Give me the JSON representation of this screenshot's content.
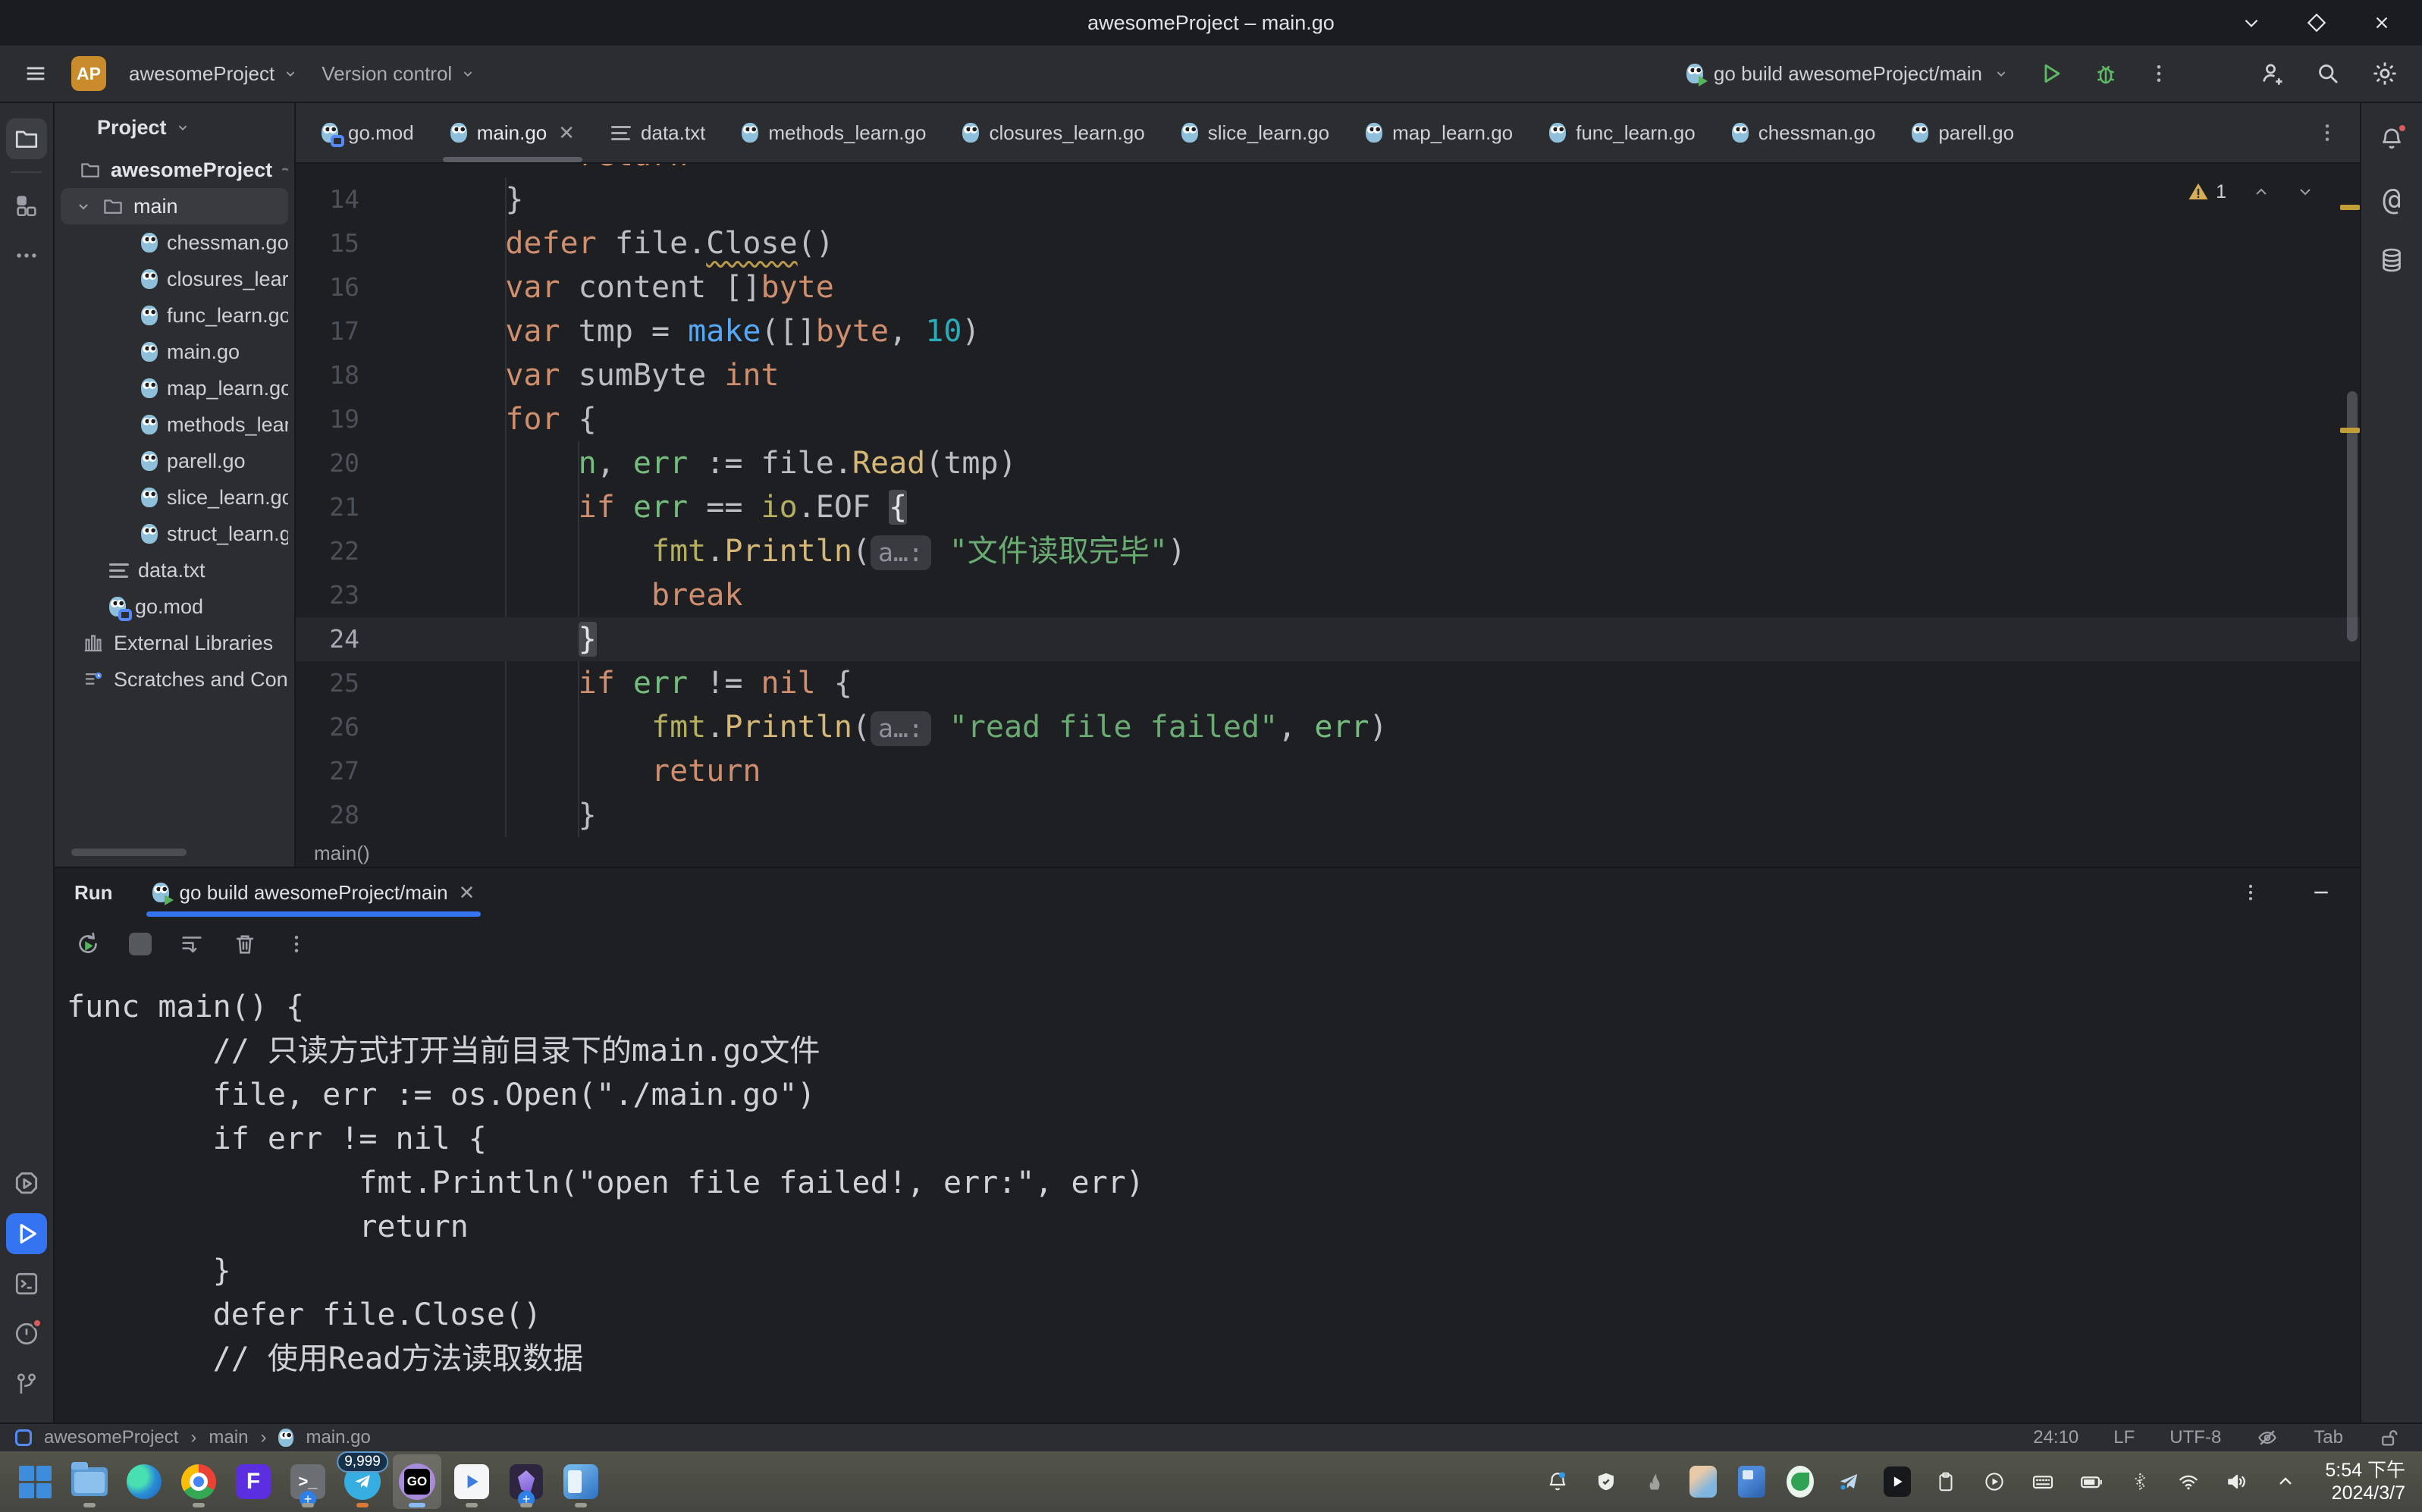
{
  "window": {
    "title": "awesomeProject – main.go"
  },
  "toolbar": {
    "project_abbrev": "AP",
    "project_name": "awesomeProject",
    "version_control_label": "Version control",
    "run_config": "go build awesomeProject/main"
  },
  "project_panel": {
    "header": "Project",
    "items": [
      {
        "pad": 24,
        "icon": "folder",
        "label": "awesomeProject",
        "hint": "~/Gola",
        "bold": true
      },
      {
        "pad": 18,
        "chevron": true,
        "icon": "folder",
        "label": "main",
        "selected": true
      },
      {
        "pad": 106,
        "icon": "go",
        "label": "chessman.go"
      },
      {
        "pad": 106,
        "icon": "go",
        "label": "closures_learn.go"
      },
      {
        "pad": 106,
        "icon": "go",
        "label": "func_learn.go"
      },
      {
        "pad": 106,
        "icon": "go",
        "label": "main.go"
      },
      {
        "pad": 106,
        "icon": "go",
        "label": "map_learn.go"
      },
      {
        "pad": 106,
        "icon": "go",
        "label": "methods_learn.go"
      },
      {
        "pad": 106,
        "icon": "go",
        "label": "parell.go"
      },
      {
        "pad": 106,
        "icon": "go",
        "label": "slice_learn.go"
      },
      {
        "pad": 106,
        "icon": "go",
        "label": "struct_learn.go"
      },
      {
        "pad": 64,
        "icon": "txt",
        "label": "data.txt"
      },
      {
        "pad": 64,
        "icon": "gomod",
        "label": "go.mod"
      },
      {
        "pad": 28,
        "icon": "lib",
        "label": "External Libraries"
      },
      {
        "pad": 28,
        "icon": "scratch",
        "label": "Scratches and Consoles"
      }
    ]
  },
  "editor": {
    "tabs": [
      {
        "label": "go.mod",
        "icon": "gomod"
      },
      {
        "label": "main.go",
        "icon": "go",
        "active": true,
        "close": true
      },
      {
        "label": "data.txt",
        "icon": "txt"
      },
      {
        "label": "methods_learn.go",
        "icon": "go"
      },
      {
        "label": "closures_learn.go",
        "icon": "go"
      },
      {
        "label": "slice_learn.go",
        "icon": "go"
      },
      {
        "label": "map_learn.go",
        "icon": "go"
      },
      {
        "label": "func_learn.go",
        "icon": "go"
      },
      {
        "label": "chessman.go",
        "icon": "go"
      },
      {
        "label": "parell.go",
        "icon": "go"
      }
    ],
    "warning_count": "1",
    "breadcrumb": "main()",
    "lines": [
      {
        "num": "",
        "ind": 2,
        "partial": true,
        "tokens": [
          {
            "c": "kw",
            "t": "return"
          }
        ]
      },
      {
        "num": "14",
        "ind": 1,
        "tokens": [
          {
            "c": "v",
            "t": "}"
          }
        ]
      },
      {
        "num": "15",
        "ind": 1,
        "tokens": [
          {
            "c": "kw",
            "t": "defer"
          },
          {
            "c": "v",
            "t": " file."
          },
          {
            "c": "wavy",
            "t": "Close"
          },
          {
            "c": "v",
            "t": "()"
          }
        ]
      },
      {
        "num": "16",
        "ind": 1,
        "tokens": [
          {
            "c": "kw",
            "t": "var"
          },
          {
            "c": "v",
            "t": " content []"
          },
          {
            "c": "kw",
            "t": "byte"
          }
        ]
      },
      {
        "num": "17",
        "ind": 1,
        "tokens": [
          {
            "c": "kw",
            "t": "var"
          },
          {
            "c": "v",
            "t": " tmp = "
          },
          {
            "c": "bfn",
            "t": "make"
          },
          {
            "c": "v",
            "t": "([]"
          },
          {
            "c": "kw",
            "t": "byte"
          },
          {
            "c": "v",
            "t": ", "
          },
          {
            "c": "num",
            "t": "10"
          },
          {
            "c": "v",
            "t": ")"
          }
        ]
      },
      {
        "num": "18",
        "ind": 1,
        "tokens": [
          {
            "c": "kw",
            "t": "var"
          },
          {
            "c": "v",
            "t": " sumByte "
          },
          {
            "c": "kw",
            "t": "int"
          }
        ]
      },
      {
        "num": "19",
        "ind": 1,
        "tokens": [
          {
            "c": "kw",
            "t": "for"
          },
          {
            "c": "v",
            "t": " {"
          }
        ]
      },
      {
        "num": "20",
        "ind": 2,
        "tokens": [
          {
            "c": "gv",
            "t": "n"
          },
          {
            "c": "v",
            "t": ", "
          },
          {
            "c": "gv",
            "t": "err"
          },
          {
            "c": "v",
            "t": " := file."
          },
          {
            "c": "fn",
            "t": "Read"
          },
          {
            "c": "v",
            "t": "(tmp)"
          }
        ]
      },
      {
        "num": "21",
        "ind": 2,
        "tokens": [
          {
            "c": "kw",
            "t": "if"
          },
          {
            "c": "v",
            "t": " "
          },
          {
            "c": "gv",
            "t": "err"
          },
          {
            "c": "v",
            "t": " == "
          },
          {
            "c": "pkg",
            "t": "io"
          },
          {
            "c": "v",
            "t": ".EOF "
          },
          {
            "c": "brace",
            "t": "{"
          }
        ]
      },
      {
        "num": "22",
        "ind": 3,
        "tokens": [
          {
            "c": "pkg",
            "t": "fmt"
          },
          {
            "c": "v",
            "t": "."
          },
          {
            "c": "fn",
            "t": "Println"
          },
          {
            "c": "v",
            "t": "("
          },
          {
            "c": "hint",
            "t": "a…:"
          },
          {
            "c": "v",
            "t": " "
          },
          {
            "c": "str",
            "t": "\"文件读取完毕\""
          },
          {
            "c": "v",
            "t": ")"
          }
        ]
      },
      {
        "num": "23",
        "ind": 3,
        "tokens": [
          {
            "c": "kw",
            "t": "break"
          }
        ]
      },
      {
        "num": "24",
        "ind": 2,
        "caret": true,
        "tokens": [
          {
            "c": "brace",
            "t": "}"
          }
        ]
      },
      {
        "num": "25",
        "ind": 2,
        "tokens": [
          {
            "c": "kw",
            "t": "if"
          },
          {
            "c": "v",
            "t": " "
          },
          {
            "c": "gv",
            "t": "err"
          },
          {
            "c": "v",
            "t": " != "
          },
          {
            "c": "kw",
            "t": "nil"
          },
          {
            "c": "v",
            "t": " {"
          }
        ]
      },
      {
        "num": "26",
        "ind": 3,
        "tokens": [
          {
            "c": "pkg",
            "t": "fmt"
          },
          {
            "c": "v",
            "t": "."
          },
          {
            "c": "fn",
            "t": "Println"
          },
          {
            "c": "v",
            "t": "("
          },
          {
            "c": "hint",
            "t": "a…:"
          },
          {
            "c": "v",
            "t": " "
          },
          {
            "c": "str",
            "t": "\"read file failed\""
          },
          {
            "c": "v",
            "t": ", "
          },
          {
            "c": "gv",
            "t": "err"
          },
          {
            "c": "v",
            "t": ")"
          }
        ]
      },
      {
        "num": "27",
        "ind": 3,
        "tokens": [
          {
            "c": "kw",
            "t": "return"
          }
        ]
      },
      {
        "num": "28",
        "ind": 2,
        "tokens": [
          {
            "c": "v",
            "t": "}"
          }
        ]
      }
    ]
  },
  "run_panel": {
    "title": "Run",
    "tab": "go build awesomeProject/main",
    "console": [
      {
        "ind": 0,
        "t": "func main() {"
      },
      {
        "ind": 1,
        "t": "// 只读方式打开当前目录下的main.go文件"
      },
      {
        "ind": 1,
        "t": "file, err := os.Open(\"./main.go\")"
      },
      {
        "ind": 1,
        "t": "if err != nil {"
      },
      {
        "ind": 2,
        "t": "fmt.Println(\"open file failed!, err:\", err)"
      },
      {
        "ind": 2,
        "t": "return"
      },
      {
        "ind": 1,
        "t": "}"
      },
      {
        "ind": 1,
        "t": "defer file.Close()"
      },
      {
        "ind": 1,
        "t": "// 使用Read方法读取数据"
      }
    ]
  },
  "status_bar": {
    "crumbs": [
      "awesomeProject",
      "main",
      "main.go"
    ],
    "position": "24:10",
    "line_ending": "LF",
    "encoding": "UTF-8",
    "indent": "Tab"
  },
  "taskbar": {
    "apps": [
      {
        "name": "windows-start"
      },
      {
        "name": "file-explorer",
        "indicator": "grey"
      },
      {
        "name": "edge"
      },
      {
        "name": "chrome",
        "indicator": "grey"
      },
      {
        "name": "fdm"
      },
      {
        "name": "terminal",
        "badge_plus": true,
        "indicator": "grey"
      },
      {
        "name": "telegram",
        "badge": "9,999",
        "indicator": "orange"
      },
      {
        "name": "goland",
        "active": true,
        "indicator": "blue"
      },
      {
        "name": "potplayer",
        "indicator": "grey"
      },
      {
        "name": "obsidian",
        "badge_plus": true,
        "indicator": "grey"
      },
      {
        "name": "blue-app",
        "indicator": "grey"
      }
    ],
    "tray": [
      "bell",
      "shield",
      "flame",
      "chara",
      "wallpaper",
      "leaf",
      "plane",
      "play",
      "clipboard",
      "circle-play",
      "keyboard",
      "battery",
      "bluetooth",
      "wifi",
      "volume",
      "chevron-up"
    ],
    "clock_time": "5:54 下午",
    "clock_date": "2024/3/7"
  }
}
